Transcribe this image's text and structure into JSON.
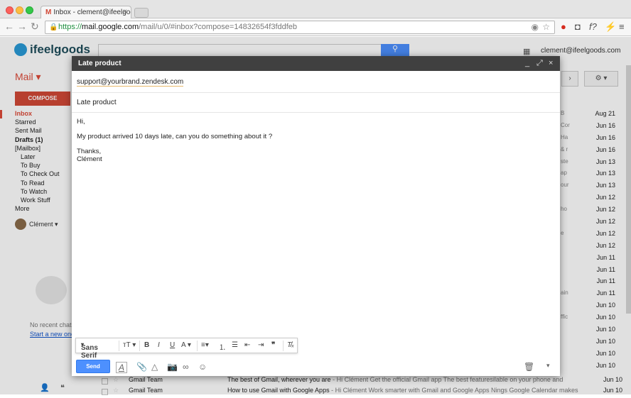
{
  "browser": {
    "tab_title": "Inbox - clement@ifeelgoods",
    "tab_gmail_icon": "M",
    "tab_close": "×",
    "url_https": "https://",
    "url_domain": "mail.google.com",
    "url_path": "/mail/u/0/#inbox?compose=14832654f3fddfeb",
    "back": "←",
    "forward": "→",
    "reload": "↻"
  },
  "gmail": {
    "logo_text": "ifeelgoods",
    "account": "clement@ifeelgoods.com",
    "mail_label": "Mail",
    "compose_label": "COMPOSE",
    "nav": [
      {
        "label": "Inbox",
        "style": "active"
      },
      {
        "label": "Starred",
        "style": ""
      },
      {
        "label": "Sent Mail",
        "style": ""
      },
      {
        "label": "Drafts (1)",
        "style": "bold"
      },
      {
        "label": "[Mailbox]",
        "style": ""
      },
      {
        "label": "Later",
        "style": "indent"
      },
      {
        "label": "To Buy",
        "style": "indent"
      },
      {
        "label": "To Check Out",
        "style": "indent"
      },
      {
        "label": "To Read",
        "style": "indent"
      },
      {
        "label": "To Watch",
        "style": "indent"
      },
      {
        "label": "Work Stuff",
        "style": "indent"
      },
      {
        "label": "More",
        "style": ""
      }
    ],
    "chat_user": "Clément",
    "no_recent_chats": "No recent chats",
    "start_new_chat": "Start a new one",
    "dates": [
      "Aug 21",
      "Jun 16",
      "Jun 16",
      "Jun 16",
      "Jun 13",
      "Jun 13",
      "Jun 13",
      "Jun 12",
      "Jun 12",
      "Jun 12",
      "Jun 12",
      "Jun 12",
      "Jun 11",
      "Jun 11",
      "Jun 11",
      "Jun 11",
      "Jun 10",
      "Jun 10",
      "Jun 10",
      "Jun 10",
      "Jun 10",
      "Jun 10"
    ],
    "snippets_right": [
      "B",
      "Cor",
      "Ha",
      "& r",
      "ste",
      "ap",
      "our",
      "",
      "ho",
      "",
      "e",
      "",
      "",
      "",
      "",
      "ain",
      "",
      "ffic",
      "",
      "",
      "",
      ""
    ],
    "bottom_rows": [
      {
        "from": "Gmail Team",
        "subject": "The best of Gmail, wherever you are",
        "snippet": " - Hi Clément Get the official Gmail app The best featuresilable on your phone and",
        "date": "Jun 10"
      },
      {
        "from": "Gmail Team",
        "subject": "How to use Gmail with Google Apps",
        "snippet": " - Hi Clément Work smarter with Gmail and Google Apps Nings Google Calendar makes",
        "date": "Jun 10"
      }
    ]
  },
  "compose": {
    "title": "Late product",
    "to": "support@yourbrand.zendesk.com",
    "subject": "Late product",
    "body": [
      "Hi,",
      "",
      "My product arrived 10 days late, can you do something about it ?",
      "",
      "Thanks,",
      "Clément"
    ],
    "font_name": "Sans Serif",
    "send_label": "Send",
    "controls": {
      "minimize": "_",
      "popout": "⤢",
      "close": "×"
    }
  }
}
